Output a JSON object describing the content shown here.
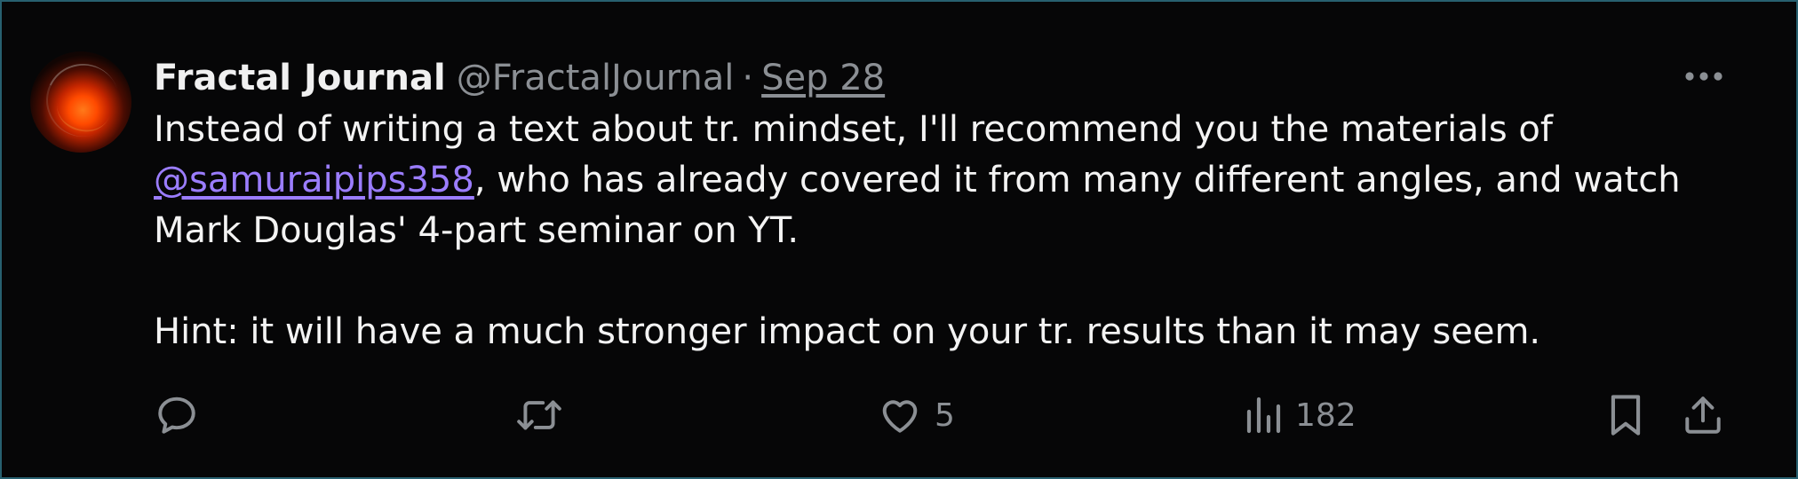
{
  "tweet": {
    "author": {
      "display_name": "Fractal Journal",
      "handle": "@FractalJournal"
    },
    "separator": "·",
    "date": "Sep 28",
    "body": {
      "p1_before_mention": "Instead of writing a text about tr. mindset, I'll recommend you the materials of ",
      "mention": "@samuraipips358",
      "p1_after_mention": ", who has already covered it from many different angles, and watch Mark Douglas' 4-part seminar on YT.",
      "p2": "Hint: it will have a much stronger impact on your tr. results than it may seem."
    },
    "stats": {
      "likes": "5",
      "views": "182"
    }
  },
  "icons": {
    "more": "more-horizontal-icon",
    "reply": "speech-bubble-icon",
    "retweet": "retweet-arrows-icon",
    "like": "heart-icon",
    "views": "bar-chart-icon",
    "bookmark": "bookmark-icon",
    "share": "share-upload-icon"
  },
  "colors": {
    "background": "#060607",
    "text_primary": "#f3f3f3",
    "text_secondary": "#8b8f94",
    "mention": "#9b7dff",
    "frame_border": "#27606f"
  }
}
